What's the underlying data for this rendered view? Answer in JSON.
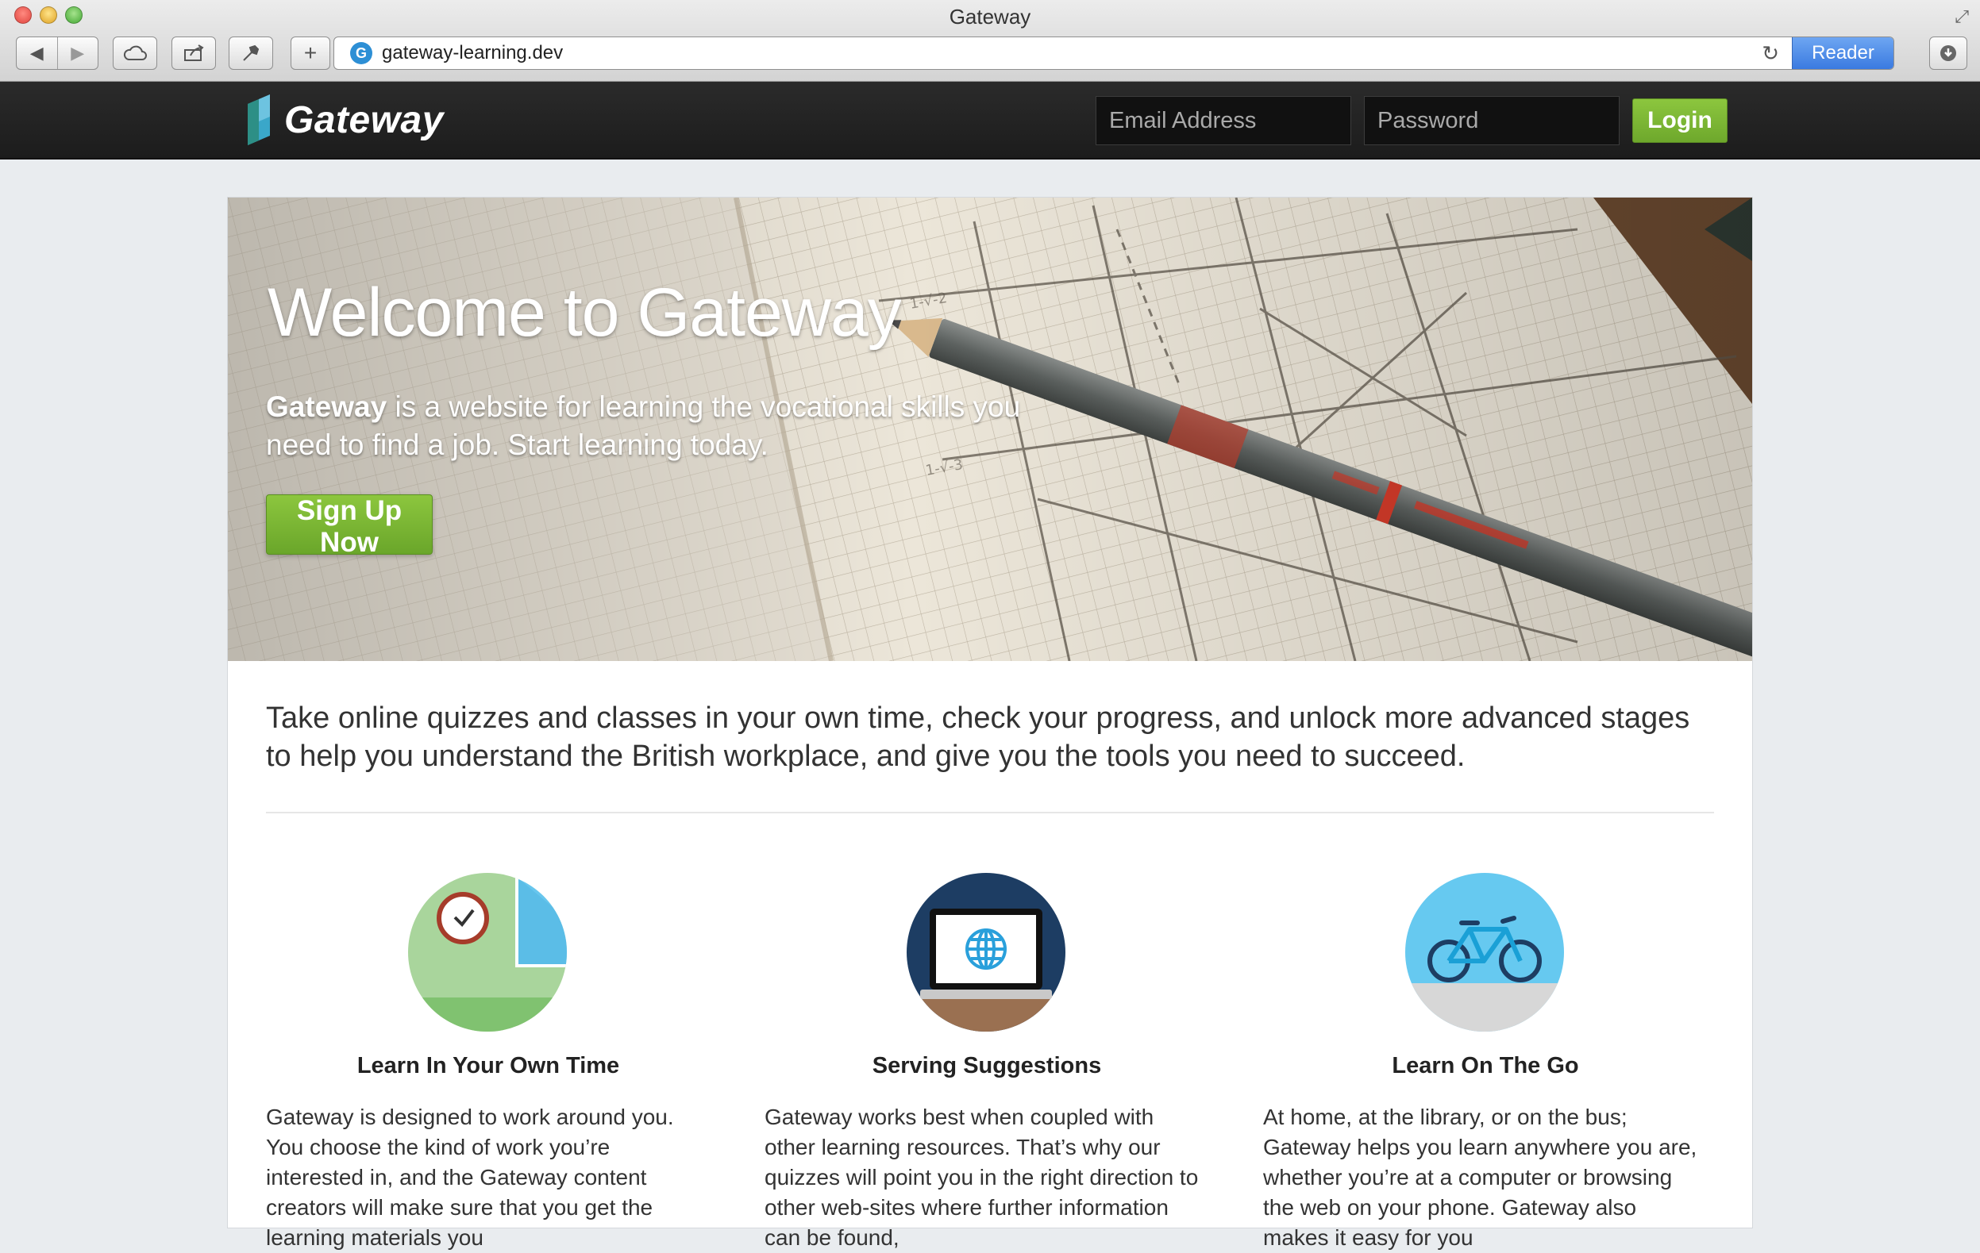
{
  "window": {
    "title": "Gateway"
  },
  "browser": {
    "url": "gateway-learning.dev",
    "favicon_letter": "G",
    "reader_label": "Reader",
    "icons": [
      "back-icon",
      "forward-icon",
      "icloud-tabs-icon",
      "share-icon",
      "tools-icon",
      "new-tab-icon",
      "reload-icon",
      "downloads-icon",
      "fullscreen-icon"
    ]
  },
  "site_header": {
    "logo_text": "Gateway",
    "email_placeholder": "Email Address",
    "password_placeholder": "Password",
    "login_label": "Login",
    "colors": {
      "header_bg": "#222222",
      "accent_green": "#7cb936"
    }
  },
  "hero": {
    "title": "Welcome to Gateway",
    "text_bold": "Gateway",
    "text_rest": " is a website for learning the vocational skills you need to find a job. Start learning today.",
    "cta_label": "Sign Up Now"
  },
  "intro": {
    "text": "Take online quizzes and classes in your own time, check your progress, and unlock more advanced stages to help you understand the British workplace, and give you the tools you need to succeed."
  },
  "features": [
    {
      "icon": "clock-chart-icon",
      "title": "Learn In Your Own Time",
      "text": "Gateway is designed to work around you. You choose the kind of work you’re interested in, and the Gateway content creators will make sure that you get the learning materials you"
    },
    {
      "icon": "laptop-globe-icon",
      "title": "Serving Suggestions",
      "text": "Gateway works best when coupled with other learning resources. That’s why our quizzes will point you in the right direction to other web-sites where further information can be found,"
    },
    {
      "icon": "bicycle-icon",
      "title": "Learn On The Go",
      "text": "At home, at the library, or on the bus; Gateway helps you learn anywhere you are, whether you’re at a computer or browsing the web on your phone. Gateway also makes it easy for you"
    }
  ]
}
